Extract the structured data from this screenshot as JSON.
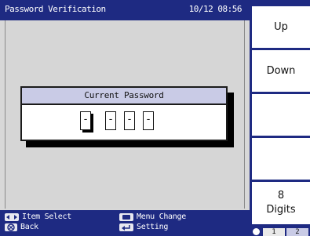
{
  "header": {
    "title": "Password Verification",
    "datetime": "10/12 08:56"
  },
  "dialog": {
    "title": "Current Password",
    "digits": [
      "-",
      "-",
      "-",
      "-"
    ]
  },
  "hints": {
    "item_select": "Item Select",
    "back": "Back",
    "menu_change": "Menu Change",
    "setting": "Setting"
  },
  "softkeys": {
    "up": "Up",
    "down": "Down",
    "digits_count": "8",
    "digits_label": "Digits"
  },
  "pager": {
    "page1": "1",
    "page2": "2"
  },
  "colors": {
    "bar": "#1e2a82",
    "dialog_header": "#c9cbe6",
    "panel": "#d6d6d6"
  }
}
